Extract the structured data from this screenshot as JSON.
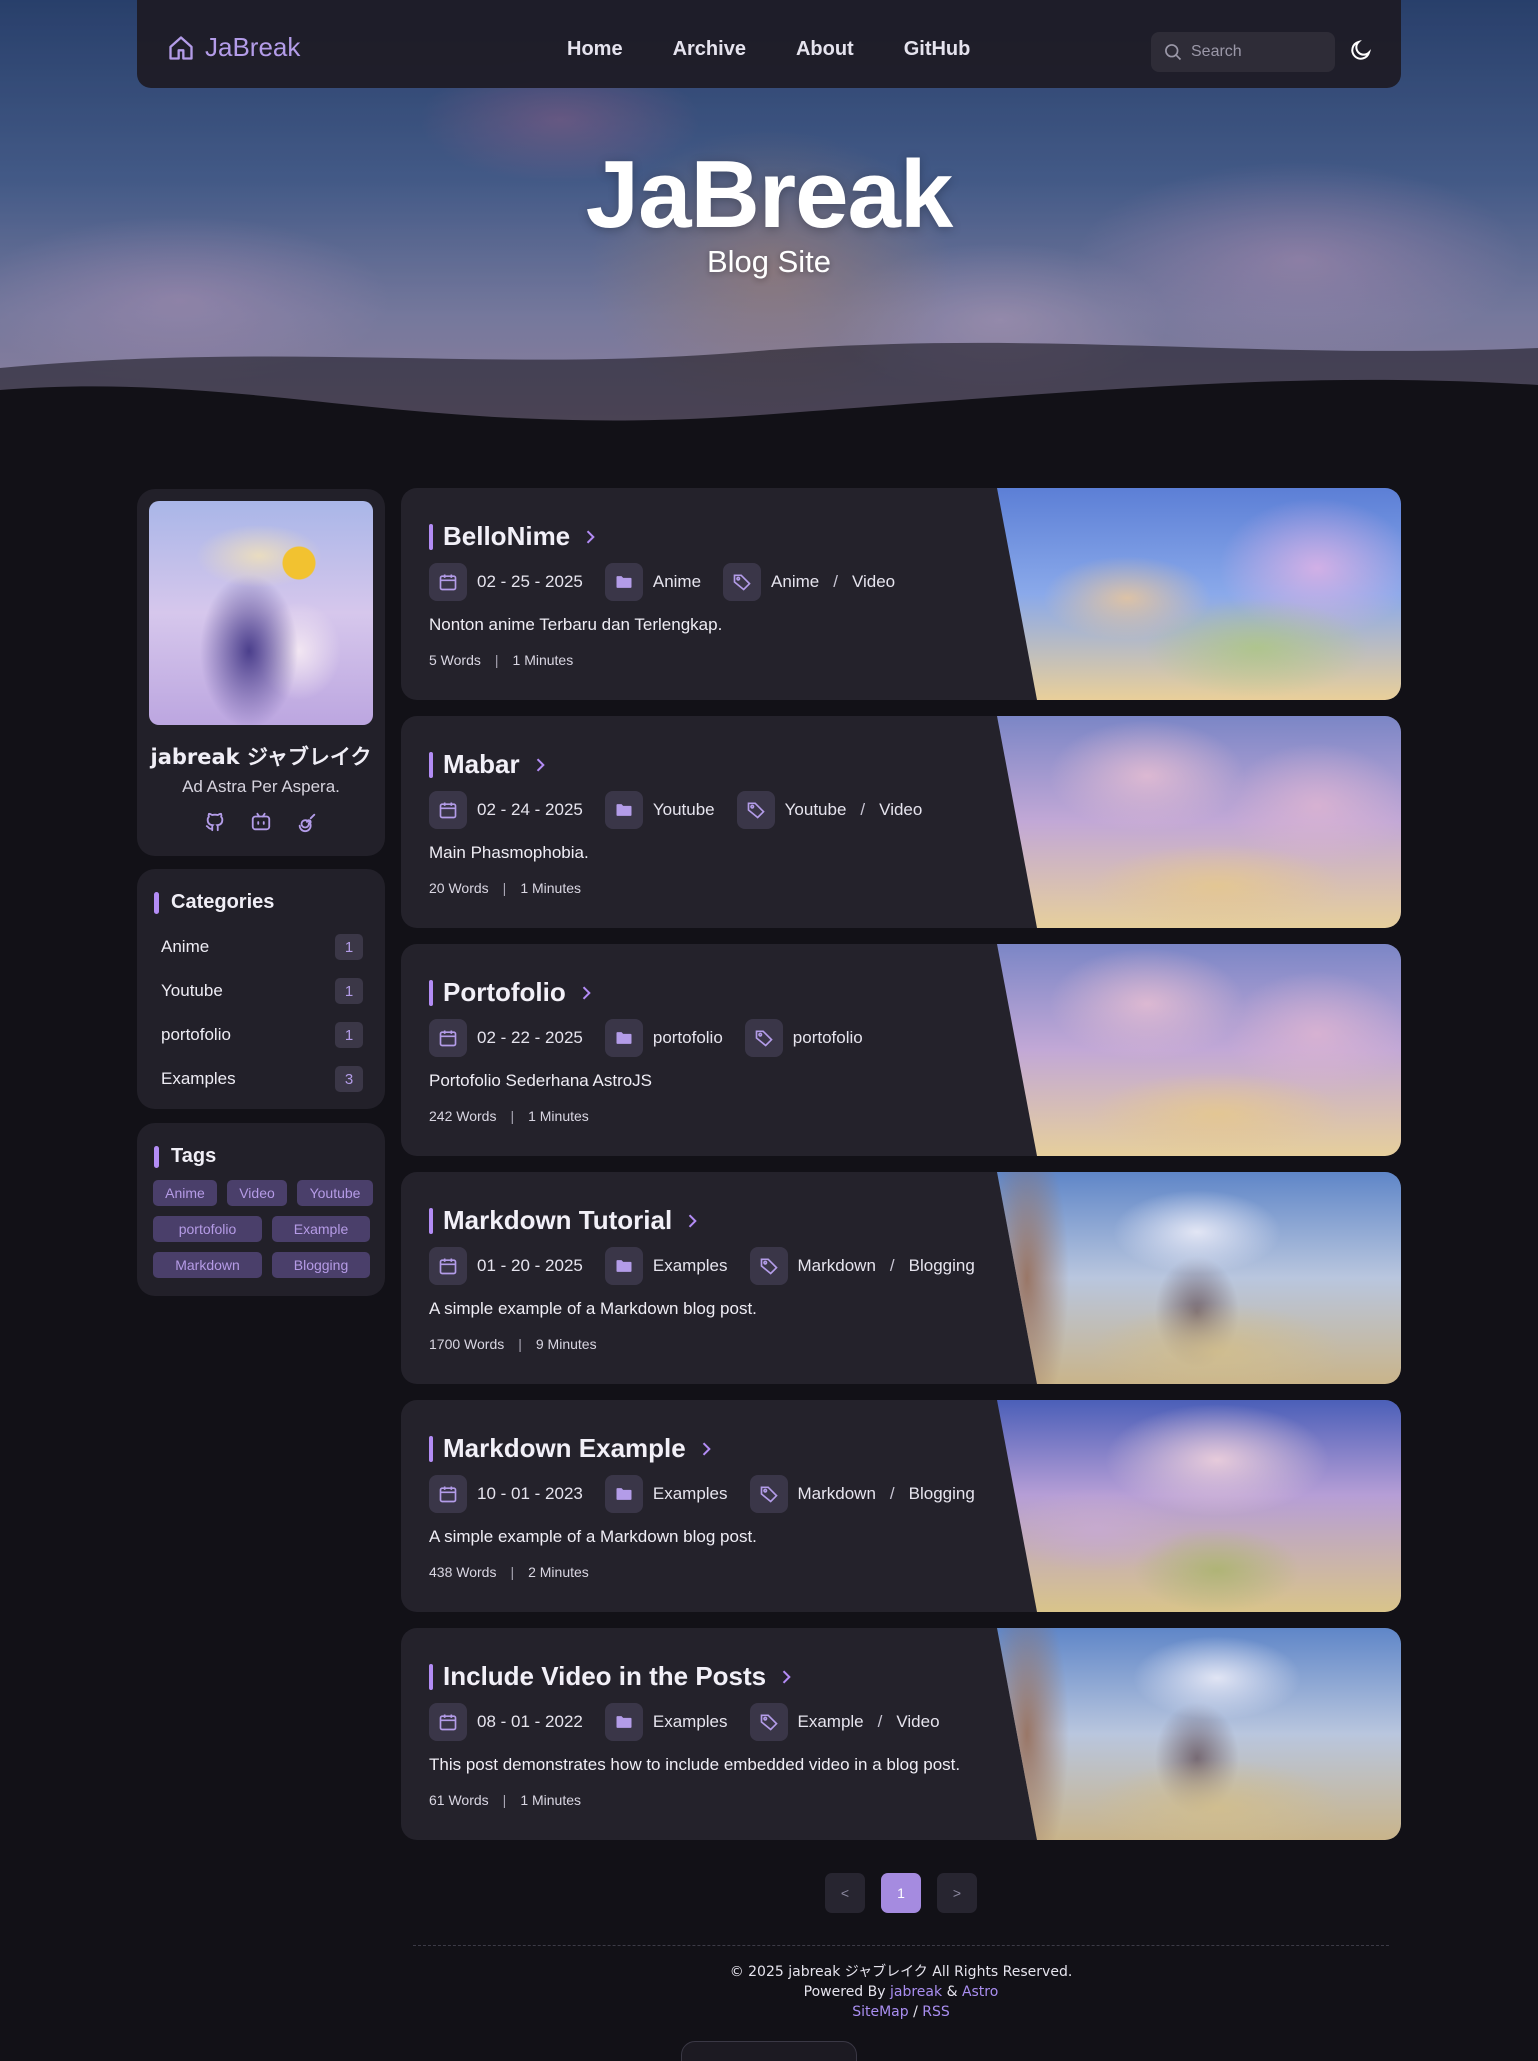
{
  "nav": {
    "brand": "JaBreak",
    "links": [
      "Home",
      "Archive",
      "About",
      "GitHub"
    ],
    "search_placeholder": "Search"
  },
  "hero": {
    "title": "JaBreak",
    "subtitle": "Blog Site"
  },
  "profile": {
    "name": "jabreak ジャブレイク",
    "motto": "Ad Astra Per Aspera.",
    "social_icons": [
      "github-icon",
      "bilibili-icon",
      "spiral-icon"
    ]
  },
  "categories": {
    "title": "Categories",
    "items": [
      {
        "name": "Anime",
        "count": "1"
      },
      {
        "name": "Youtube",
        "count": "1"
      },
      {
        "name": "portofolio",
        "count": "1"
      },
      {
        "name": "Examples",
        "count": "3"
      }
    ]
  },
  "tags": {
    "title": "Tags",
    "items": [
      "Anime",
      "Video",
      "Youtube",
      "portofolio",
      "Example",
      "Markdown",
      "Blogging"
    ]
  },
  "posts": [
    {
      "title": "BelloNime",
      "date": "02 - 25 - 2025",
      "category": "Anime",
      "tags": [
        "Anime",
        "Video"
      ],
      "desc": "Nonton anime Terbaru dan Terlengkap.",
      "words": "5 Words",
      "minutes": "1 Minutes"
    },
    {
      "title": "Mabar",
      "date": "02 - 24 - 2025",
      "category": "Youtube",
      "tags": [
        "Youtube",
        "Video"
      ],
      "desc": "Main Phasmophobia.",
      "words": "20 Words",
      "minutes": "1 Minutes"
    },
    {
      "title": "Portofolio",
      "date": "02 - 22 - 2025",
      "category": "portofolio",
      "tags": [
        "portofolio"
      ],
      "desc": "Portofolio Sederhana AstroJS",
      "words": "242 Words",
      "minutes": "1 Minutes"
    },
    {
      "title": "Markdown Tutorial",
      "date": "01 - 20 - 2025",
      "category": "Examples",
      "tags": [
        "Markdown",
        "Blogging"
      ],
      "desc": "A simple example of a Markdown blog post.",
      "words": "1700 Words",
      "minutes": "9 Minutes"
    },
    {
      "title": "Markdown Example",
      "date": "10 - 01 - 2023",
      "category": "Examples",
      "tags": [
        "Markdown",
        "Blogging"
      ],
      "desc": "A simple example of a Markdown blog post.",
      "words": "438 Words",
      "minutes": "2 Minutes"
    },
    {
      "title": "Include Video in the Posts",
      "date": "08 - 01 - 2022",
      "category": "Examples",
      "tags": [
        "Example",
        "Video"
      ],
      "desc": "This post demonstrates how to include embedded video in a blog post.",
      "words": "61 Words",
      "minutes": "1 Minutes"
    }
  ],
  "pagination": {
    "prev": "<",
    "current": "1",
    "next": ">"
  },
  "footer": {
    "copyright": "© 2025 jabreak ジャブレイク All Rights Reserved.",
    "powered_prefix": "Powered By",
    "powered_author": "jabreak",
    "powered_amp": "&",
    "powered_framework": "Astro",
    "sitemap": "SiteMap",
    "slash": "/",
    "rss": "RSS"
  },
  "colors": {
    "accent": "#b38cf5",
    "background": "#121117",
    "card": "#222029"
  }
}
